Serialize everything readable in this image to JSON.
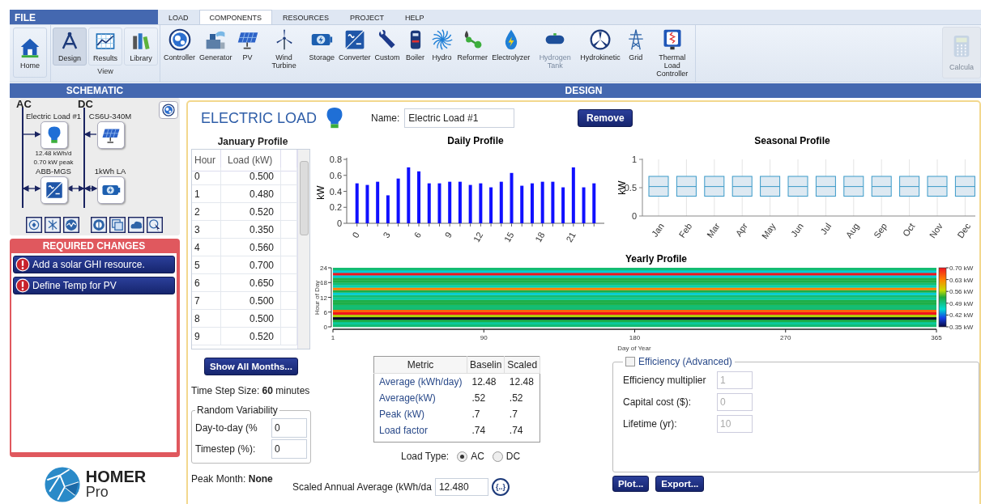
{
  "menu": {
    "file": "FILE",
    "tabs": [
      {
        "label": "LOAD",
        "selected": false
      },
      {
        "label": "COMPONENTS",
        "selected": true
      },
      {
        "label": "RESOURCES",
        "selected": false
      },
      {
        "label": "PROJECT",
        "selected": false
      },
      {
        "label": "HELP",
        "selected": false
      }
    ]
  },
  "ribbon": {
    "home": "Home",
    "view": {
      "label": "View",
      "items": [
        {
          "label": "Design",
          "selected": true
        },
        {
          "label": "Results",
          "selected": false
        },
        {
          "label": "Library",
          "selected": false
        }
      ]
    },
    "components": [
      {
        "label": "Controller",
        "disabled": false
      },
      {
        "label": "Generator",
        "disabled": false
      },
      {
        "label": "PV",
        "disabled": false
      },
      {
        "label": "Wind Turbine",
        "disabled": false
      },
      {
        "label": "Storage",
        "disabled": false
      },
      {
        "label": "Converter",
        "disabled": false
      },
      {
        "label": "Custom",
        "disabled": false
      },
      {
        "label": "Boiler",
        "disabled": false
      },
      {
        "label": "Hydro",
        "disabled": false
      },
      {
        "label": "Reformer",
        "disabled": false
      },
      {
        "label": "Electrolyzer",
        "disabled": false
      },
      {
        "label": "Hydrogen Tank",
        "disabled": true
      },
      {
        "label": "Hydrokinetic",
        "disabled": false
      },
      {
        "label": "Grid",
        "disabled": false
      },
      {
        "label": "Thermal Load Controller",
        "disabled": false
      }
    ],
    "calculate": {
      "label": "Calcula",
      "disabled": true
    }
  },
  "headers": {
    "left": "SCHEMATIC",
    "main": "DESIGN"
  },
  "schematic": {
    "buses": [
      "AC",
      "DC"
    ],
    "nodes": [
      {
        "name": "Electric Load #1",
        "details": [
          "12.48 kWh/d",
          "0.70 kW peak"
        ]
      },
      {
        "name": "CS6U-340M"
      },
      {
        "name": "ABB-MGS"
      },
      {
        "name": "1kWh LA"
      }
    ]
  },
  "required_changes": {
    "title": "REQUIRED CHANGES",
    "items": [
      "Add a solar GHI resource.",
      "Define Temp for PV"
    ]
  },
  "logo": {
    "name": "HOMER",
    "edition": "Pro"
  },
  "load": {
    "title": "ELECTRIC LOAD",
    "name_label": "Name:",
    "name_value": "Electric Load #1",
    "remove": "Remove",
    "profile_title": "January Profile",
    "columns": [
      "Hour",
      "Load (kW)"
    ],
    "rows": [
      [
        "0",
        "0.500"
      ],
      [
        "1",
        "0.480"
      ],
      [
        "2",
        "0.520"
      ],
      [
        "3",
        "0.350"
      ],
      [
        "4",
        "0.560"
      ],
      [
        "5",
        "0.700"
      ],
      [
        "6",
        "0.650"
      ],
      [
        "7",
        "0.500"
      ],
      [
        "8",
        "0.500"
      ],
      [
        "9",
        "0.520"
      ]
    ],
    "show_all": "Show All Months...",
    "time_step": "Time Step Size: **60** minutes",
    "random_variability": {
      "title": "Random Variability",
      "fields": [
        {
          "label": "Day-to-day (%",
          "value": "0"
        },
        {
          "label": "Timestep (%):",
          "value": "0"
        }
      ]
    },
    "peak_month": "Peak Month: **None**"
  },
  "daily": {
    "chart_data": {
      "type": "bar",
      "title": "Daily Profile",
      "ylabel": "kW",
      "x": [
        0,
        1,
        2,
        3,
        4,
        5,
        6,
        7,
        8,
        9,
        10,
        11,
        12,
        13,
        14,
        15,
        16,
        17,
        18,
        19,
        20,
        21,
        22,
        23
      ],
      "values": [
        0.5,
        0.48,
        0.52,
        0.35,
        0.56,
        0.7,
        0.65,
        0.5,
        0.5,
        0.52,
        0.52,
        0.48,
        0.5,
        0.45,
        0.52,
        0.63,
        0.47,
        0.5,
        0.52,
        0.52,
        0.45,
        0.7,
        0.45,
        0.5
      ],
      "xlim": [
        -1,
        24
      ],
      "ylim": [
        0,
        0.8
      ],
      "yticks": [
        0,
        0.2,
        0.4,
        0.6,
        0.8
      ],
      "xticks": [
        0,
        3,
        6,
        9,
        12,
        15,
        18,
        21
      ]
    }
  },
  "seasonal": {
    "title": "Seasonal Profile",
    "ylabel": "kW",
    "yticks": [
      "1",
      "0.5",
      "0"
    ],
    "months": [
      "Jan",
      "Feb",
      "Mar",
      "Apr",
      "May",
      "Jun",
      "Jul",
      "Aug",
      "Sep",
      "Oct",
      "Nov",
      "Dec"
    ]
  },
  "yearly": {
    "title": "Yearly Profile",
    "ylabel": "Hour of Day",
    "xlabel": "Day of Year",
    "yticks": [
      "24",
      "18",
      "12",
      "6",
      "0"
    ],
    "xticks": [
      "1",
      "90",
      "180",
      "270",
      "365"
    ],
    "legend": [
      "0.70 kW",
      "0.63 kW",
      "0.56 kW",
      "0.49 kW",
      "0.42 kW",
      "0.35 kW"
    ]
  },
  "metrics": {
    "columns": [
      "Metric",
      "Baselin",
      "Scaled"
    ],
    "rows": [
      [
        "Average (kWh/day)",
        "12.48",
        "12.48"
      ],
      [
        "Average(kW)",
        ".52",
        ".52"
      ],
      [
        "Peak (kW)",
        ".7",
        ".7"
      ],
      [
        "Load factor",
        ".74",
        ".74"
      ]
    ]
  },
  "load_type": {
    "label": "Load Type:",
    "options": [
      {
        "label": "AC",
        "selected": true
      },
      {
        "label": "DC",
        "selected": false
      }
    ]
  },
  "scaled_average": {
    "label": "Scaled Annual Average (kWh/da",
    "value": "12.480",
    "button": "{..}"
  },
  "efficiency": {
    "label": "Efficiency (Advanced)",
    "checked": false,
    "fields": [
      {
        "label": "Efficiency multiplier",
        "value": "1",
        "disabled": true
      },
      {
        "label": "Capital cost ($):",
        "value": "0",
        "disabled": true
      },
      {
        "label": "Lifetime (yr):",
        "value": "10",
        "disabled": true
      }
    ]
  },
  "actions": [
    "Plot...",
    "Export..."
  ]
}
